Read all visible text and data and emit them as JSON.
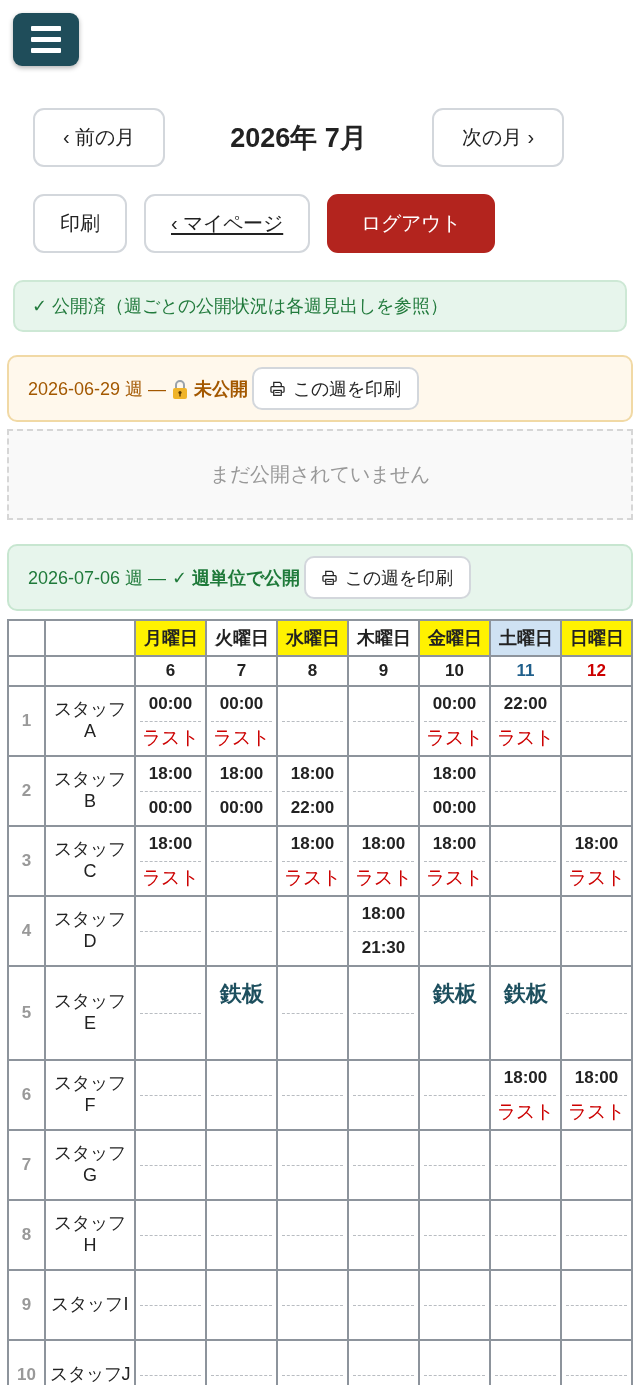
{
  "nav": {
    "prev": "‹ 前の月",
    "title": "2026年 7月",
    "next": "次の月 ›"
  },
  "actions": [
    {
      "label": "印刷",
      "kind": "print"
    },
    {
      "label": "‹ マイページ",
      "kind": "link"
    },
    {
      "label": "ログアウト",
      "kind": "logout"
    }
  ],
  "notice": "✓ 公開済（週ごとの公開状況は各週見出しを参照）",
  "weeks": [
    {
      "label": "2026-06-29 週 —",
      "published": false,
      "status": "未公開",
      "print_button": "この週を印刷",
      "empty_message": "まだ公開されていません"
    },
    {
      "label": "2026-07-06 週 —",
      "published": true,
      "status": "✓ 週単位で公開",
      "print_button": "この週を印刷",
      "table": {
        "days": [
          {
            "label": "月曜日",
            "color": "#fff200",
            "date": {
              "text": "6",
              "color": "#222222"
            }
          },
          {
            "label": "火曜日",
            "color": "#ffffff",
            "date": {
              "text": "7",
              "color": "#222222"
            }
          },
          {
            "label": "水曜日",
            "color": "#fff200",
            "date": {
              "text": "8",
              "color": "#222222"
            }
          },
          {
            "label": "木曜日",
            "color": "#ffffff",
            "date": {
              "text": "9",
              "color": "#222222"
            }
          },
          {
            "label": "金曜日",
            "color": "#fff200",
            "date": {
              "text": "10",
              "color": "#222222"
            }
          },
          {
            "label": "土曜日",
            "color": "#cfe2f3",
            "date": {
              "text": "11",
              "color": "#1f5f8b"
            }
          },
          {
            "label": "日曜日",
            "color": "#fff200",
            "date": {
              "text": "12",
              "color": "#cc0000"
            }
          }
        ],
        "rows": [
          {
            "number": "1",
            "name": "スタッフA",
            "cells": [
              {
                "kind": "shift",
                "start": "00:00",
                "end": {
                  "text": "ラスト",
                  "kind": "last"
                }
              },
              {
                "kind": "shift",
                "start": "00:00",
                "end": {
                  "text": "ラスト",
                  "kind": "last"
                }
              },
              {
                "kind": "shift"
              },
              {
                "kind": "shift"
              },
              {
                "kind": "shift",
                "start": "00:00",
                "end": {
                  "text": "ラスト",
                  "kind": "last"
                }
              },
              {
                "kind": "shift",
                "start": "22:00",
                "end": {
                  "text": "ラスト",
                  "kind": "last"
                }
              },
              {
                "kind": "shift"
              }
            ]
          },
          {
            "number": "2",
            "name": "スタッフB",
            "cells": [
              {
                "kind": "shift",
                "start": "18:00",
                "end": {
                  "text": "00:00",
                  "kind": "time"
                }
              },
              {
                "kind": "shift",
                "start": "18:00",
                "end": {
                  "text": "00:00",
                  "kind": "time"
                }
              },
              {
                "kind": "shift",
                "start": "18:00",
                "end": {
                  "text": "22:00",
                  "kind": "time"
                }
              },
              {
                "kind": "shift"
              },
              {
                "kind": "shift",
                "start": "18:00",
                "end": {
                  "text": "00:00",
                  "kind": "time"
                }
              },
              {
                "kind": "shift"
              },
              {
                "kind": "shift"
              }
            ]
          },
          {
            "number": "3",
            "name": "スタッフC",
            "cells": [
              {
                "kind": "shift",
                "start": "18:00",
                "end": {
                  "text": "ラスト",
                  "kind": "last"
                }
              },
              {
                "kind": "shift"
              },
              {
                "kind": "shift",
                "start": "18:00",
                "end": {
                  "text": "ラスト",
                  "kind": "last"
                }
              },
              {
                "kind": "shift",
                "start": "18:00",
                "end": {
                  "text": "ラスト",
                  "kind": "last"
                }
              },
              {
                "kind": "shift",
                "start": "18:00",
                "end": {
                  "text": "ラスト",
                  "kind": "last"
                }
              },
              {
                "kind": "shift"
              },
              {
                "kind": "shift",
                "start": "18:00",
                "end": {
                  "text": "ラスト",
                  "kind": "last"
                }
              }
            ]
          },
          {
            "number": "4",
            "name": "スタッフD",
            "cells": [
              {
                "kind": "shift"
              },
              {
                "kind": "shift"
              },
              {
                "kind": "shift"
              },
              {
                "kind": "shift",
                "start": "18:00",
                "end": {
                  "text": "21:30",
                  "kind": "time"
                }
              },
              {
                "kind": "shift"
              },
              {
                "kind": "shift"
              },
              {
                "kind": "shift"
              }
            ]
          },
          {
            "number": "5",
            "name": "スタッフE",
            "cells": [
              {
                "kind": "shift"
              },
              {
                "kind": "label",
                "text": "鉄板"
              },
              {
                "kind": "shift"
              },
              {
                "kind": "shift"
              },
              {
                "kind": "label",
                "text": "鉄板"
              },
              {
                "kind": "label",
                "text": "鉄板"
              },
              {
                "kind": "shift"
              }
            ]
          },
          {
            "number": "6",
            "name": "スタッフF",
            "cells": [
              {
                "kind": "shift"
              },
              {
                "kind": "shift"
              },
              {
                "kind": "shift"
              },
              {
                "kind": "shift"
              },
              {
                "kind": "shift"
              },
              {
                "kind": "shift",
                "start": "18:00",
                "end": {
                  "text": "ラスト",
                  "kind": "last"
                }
              },
              {
                "kind": "shift",
                "start": "18:00",
                "end": {
                  "text": "ラスト",
                  "kind": "last"
                }
              }
            ]
          },
          {
            "number": "7",
            "name": "スタッフG",
            "cells": [
              {
                "kind": "shift"
              },
              {
                "kind": "shift"
              },
              {
                "kind": "shift"
              },
              {
                "kind": "shift"
              },
              {
                "kind": "shift"
              },
              {
                "kind": "shift"
              },
              {
                "kind": "shift"
              }
            ]
          },
          {
            "number": "8",
            "name": "スタッフH",
            "cells": [
              {
                "kind": "shift"
              },
              {
                "kind": "shift"
              },
              {
                "kind": "shift"
              },
              {
                "kind": "shift"
              },
              {
                "kind": "shift"
              },
              {
                "kind": "shift"
              },
              {
                "kind": "shift"
              }
            ]
          },
          {
            "number": "9",
            "name": "スタッフI",
            "cells": [
              {
                "kind": "shift"
              },
              {
                "kind": "shift"
              },
              {
                "kind": "shift"
              },
              {
                "kind": "shift"
              },
              {
                "kind": "shift"
              },
              {
                "kind": "shift"
              },
              {
                "kind": "shift"
              }
            ]
          },
          {
            "number": "10",
            "name": "スタッフJ",
            "cells": [
              {
                "kind": "shift"
              },
              {
                "kind": "shift"
              },
              {
                "kind": "shift"
              },
              {
                "kind": "shift"
              },
              {
                "kind": "shift"
              },
              {
                "kind": "shift"
              },
              {
                "kind": "shift"
              }
            ]
          }
        ]
      }
    }
  ]
}
